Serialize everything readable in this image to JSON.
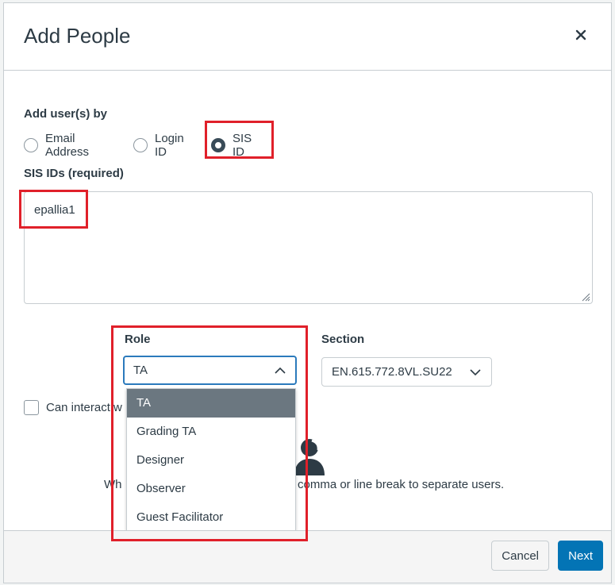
{
  "dialog": {
    "title": "Add People",
    "close_icon": "close-icon"
  },
  "add_by": {
    "label": "Add user(s) by",
    "options": [
      {
        "label": "Email Address",
        "checked": false
      },
      {
        "label": "Login ID",
        "checked": false
      },
      {
        "label": "SIS ID",
        "checked": true
      }
    ]
  },
  "sis_ids": {
    "label": "SIS IDs (required)",
    "value": "epallia1"
  },
  "role": {
    "label": "Role",
    "value": "TA",
    "options": [
      "TA",
      "Grading TA",
      "Designer",
      "Observer",
      "Guest Facilitator"
    ],
    "selected_index": 0
  },
  "section": {
    "label": "Section",
    "value": "EN.615.772.8VL.SU22"
  },
  "interact": {
    "label": "Can interact w"
  },
  "hint": {
    "left": "Wh",
    "right": "comma or line break to separate users.",
    "icon": "user-silhouette-icon"
  },
  "footer": {
    "cancel_label": "Cancel",
    "next_label": "Next"
  },
  "colors": {
    "accent": "#0374b5",
    "highlight": "#e0202a",
    "selected_option": "#6b7780",
    "focus": "#2b7abc"
  }
}
